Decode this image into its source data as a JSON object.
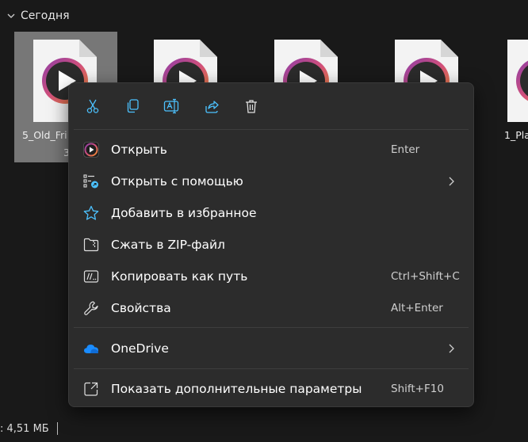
{
  "group": {
    "label": "Сегодня"
  },
  "files": [
    {
      "name_line1": "5_Old_Fri",
      "name_line2": "3"
    },
    {
      "name_line1": "",
      "name_line2": ""
    },
    {
      "name_line1": "",
      "name_line2": ""
    },
    {
      "name_line1": "",
      "name_line2": ""
    },
    {
      "name_line1": "1_Pla",
      "name_line2": ""
    }
  ],
  "status": {
    "size_text": ": 4,51 МБ"
  },
  "context_menu": {
    "toolbar": [
      {
        "icon": "cut-icon",
        "label": "Вырезать"
      },
      {
        "icon": "copy-icon",
        "label": "Копировать"
      },
      {
        "icon": "rename-icon",
        "label": "Переименовать"
      },
      {
        "icon": "share-icon",
        "label": "Поделиться"
      },
      {
        "icon": "delete-icon",
        "label": "Удалить"
      }
    ],
    "items": [
      {
        "label": "Открыть",
        "shortcut": "Enter",
        "icon": "media-player-icon"
      },
      {
        "label": "Открыть с помощью",
        "shortcut": "",
        "icon": "open-with-icon",
        "submenu": true
      },
      {
        "label": "Добавить в избранное",
        "shortcut": "",
        "icon": "star-icon"
      },
      {
        "label": "Сжать в ZIP-файл",
        "shortcut": "",
        "icon": "zip-icon"
      },
      {
        "label": "Копировать как путь",
        "shortcut": "Ctrl+Shift+C",
        "icon": "copy-path-icon"
      },
      {
        "label": "Свойства",
        "shortcut": "Alt+Enter",
        "icon": "wrench-icon"
      },
      {
        "label": "OneDrive",
        "shortcut": "",
        "icon": "onedrive-icon",
        "submenu": true
      },
      {
        "label": "Показать дополнительные параметры",
        "shortcut": "Shift+F10",
        "icon": "more-options-icon"
      }
    ]
  },
  "colors": {
    "accent": "#4cc2ff",
    "menu_bg": "#2c2c2c",
    "selection": "#777777",
    "media_orange": "#e8742a",
    "media_purple": "#8b3ca8"
  }
}
